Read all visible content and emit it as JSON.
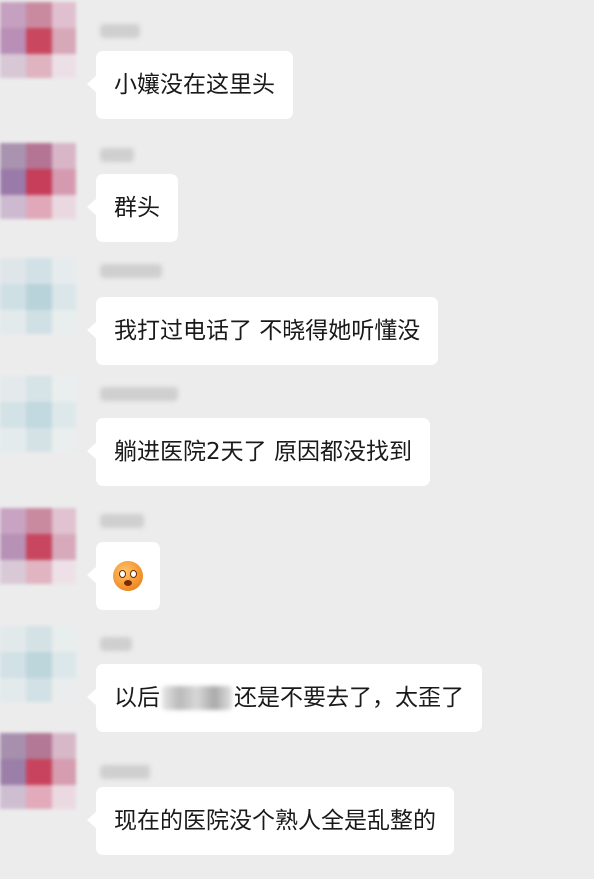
{
  "messages": [
    {
      "text": "小孃没在这里头"
    },
    {
      "text": "群头"
    },
    {
      "text": "我打过电话了 不晓得她听懂没"
    },
    {
      "text": "躺进医院2天了 原因都没找到"
    },
    {
      "emoji": "astonished-face-icon"
    },
    {
      "text_before": "以后",
      "text_after": "还是不要去了，太歪了"
    },
    {
      "text": "现在的医院没个熟人全是乱整的"
    }
  ],
  "colors": {
    "background": "#ececec",
    "bubble": "#ffffff",
    "text": "#1a1a1a"
  }
}
